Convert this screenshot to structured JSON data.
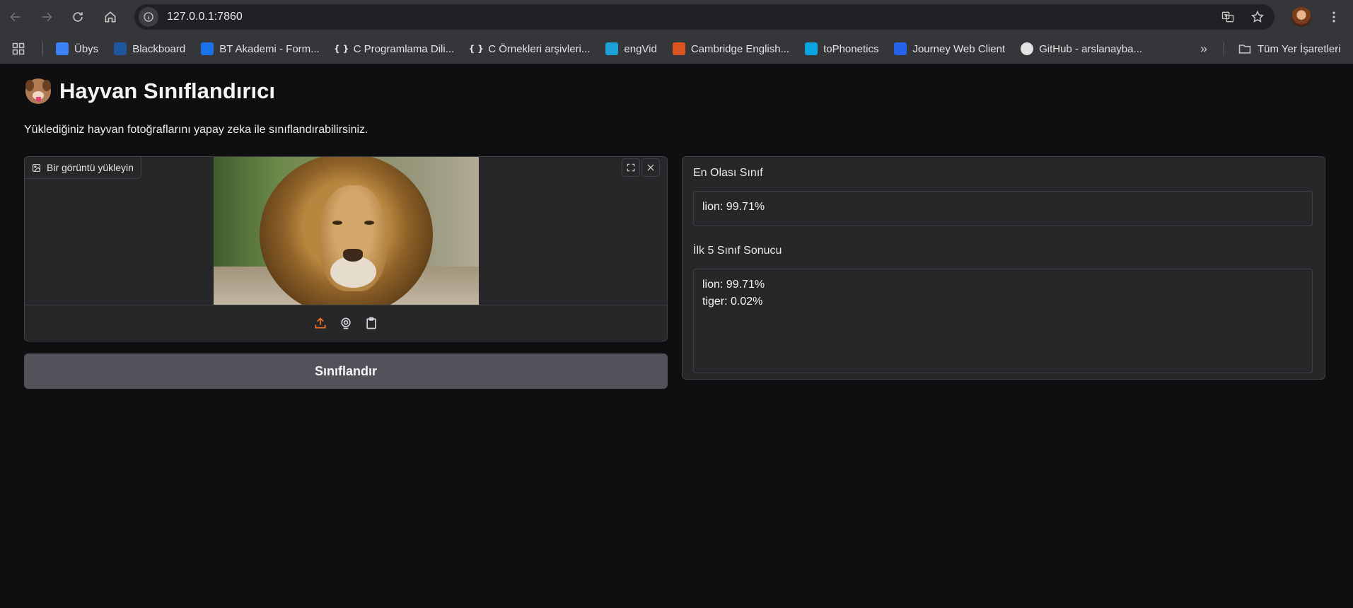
{
  "browser": {
    "url": "127.0.0.1:7860",
    "bookmarks": [
      {
        "label": "Übys",
        "icon": "ubys-icon",
        "color": "#3b82f6"
      },
      {
        "label": "Blackboard",
        "icon": "blackboard-icon",
        "color": "#1e56a0"
      },
      {
        "label": "BT Akademi - Form...",
        "icon": "btakademi-icon",
        "color": "#1a73e8"
      },
      {
        "label": "C Programlama Dili...",
        "icon": "braces-icon",
        "color": "#202124"
      },
      {
        "label": "C Örnekleri arşivleri...",
        "icon": "braces-icon",
        "color": "#202124"
      },
      {
        "label": "engVid",
        "icon": "engvid-icon",
        "color": "#1ea0d8"
      },
      {
        "label": "Cambridge English...",
        "icon": "cambridge-icon",
        "color": "#d9541e"
      },
      {
        "label": "toPhonetics",
        "icon": "tophonetics-icon",
        "color": "#0aa5e0"
      },
      {
        "label": "Journey Web Client",
        "icon": "journey-icon",
        "color": "#2563eb"
      },
      {
        "label": "GitHub - arslanayba...",
        "icon": "github-icon",
        "color": "#e3e3e3"
      }
    ],
    "all_bookmarks_label": "Tüm Yer İşaretleri"
  },
  "app": {
    "title": "Hayvan Sınıflandırıcı",
    "description": "Yüklediğiniz hayvan fotoğraflarını yapay zeka ile sınıflandırabilirsiniz.",
    "image_input_label": "Bir görüntü yükleyin",
    "classify_button": "Sınıflandır",
    "top_class_label": "En Olası Sınıf",
    "top_class_value": "lion: 99.71%",
    "top5_label": "İlk 5 Sınıf Sonucu",
    "top5_lines": [
      "lion: 99.71%",
      "tiger: 0.02%"
    ],
    "accent_color": "#f97316"
  }
}
